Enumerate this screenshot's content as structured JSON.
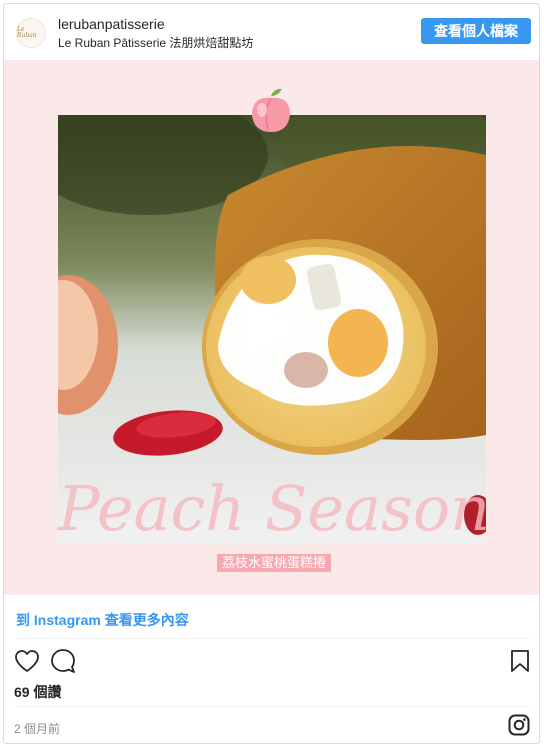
{
  "header": {
    "avatar_text": "Le Ruban",
    "username": "lerubanpatisserie",
    "subtitle": "Le Ruban Pâtisserie 法朋烘焙甜點坊",
    "view_profile_label": "查看個人檔案"
  },
  "media": {
    "overlay_script": "Peach Season",
    "product_tag": "荔枝水蜜桃蛋糕捲",
    "play_icon": "play-icon",
    "peach_icon": "peach-icon"
  },
  "more_link": "到 Instagram 查看更多內容",
  "actions": {
    "like_icon": "heart-icon",
    "comment_icon": "comment-icon",
    "save_icon": "bookmark-icon"
  },
  "likes_text": "69 個讚",
  "timestamp": "2 個月前",
  "footer_icon": "instagram-icon",
  "colors": {
    "accent": "#3897f0",
    "tag_bg": "#f6a9b0",
    "media_bg": "#fbe9ea"
  }
}
